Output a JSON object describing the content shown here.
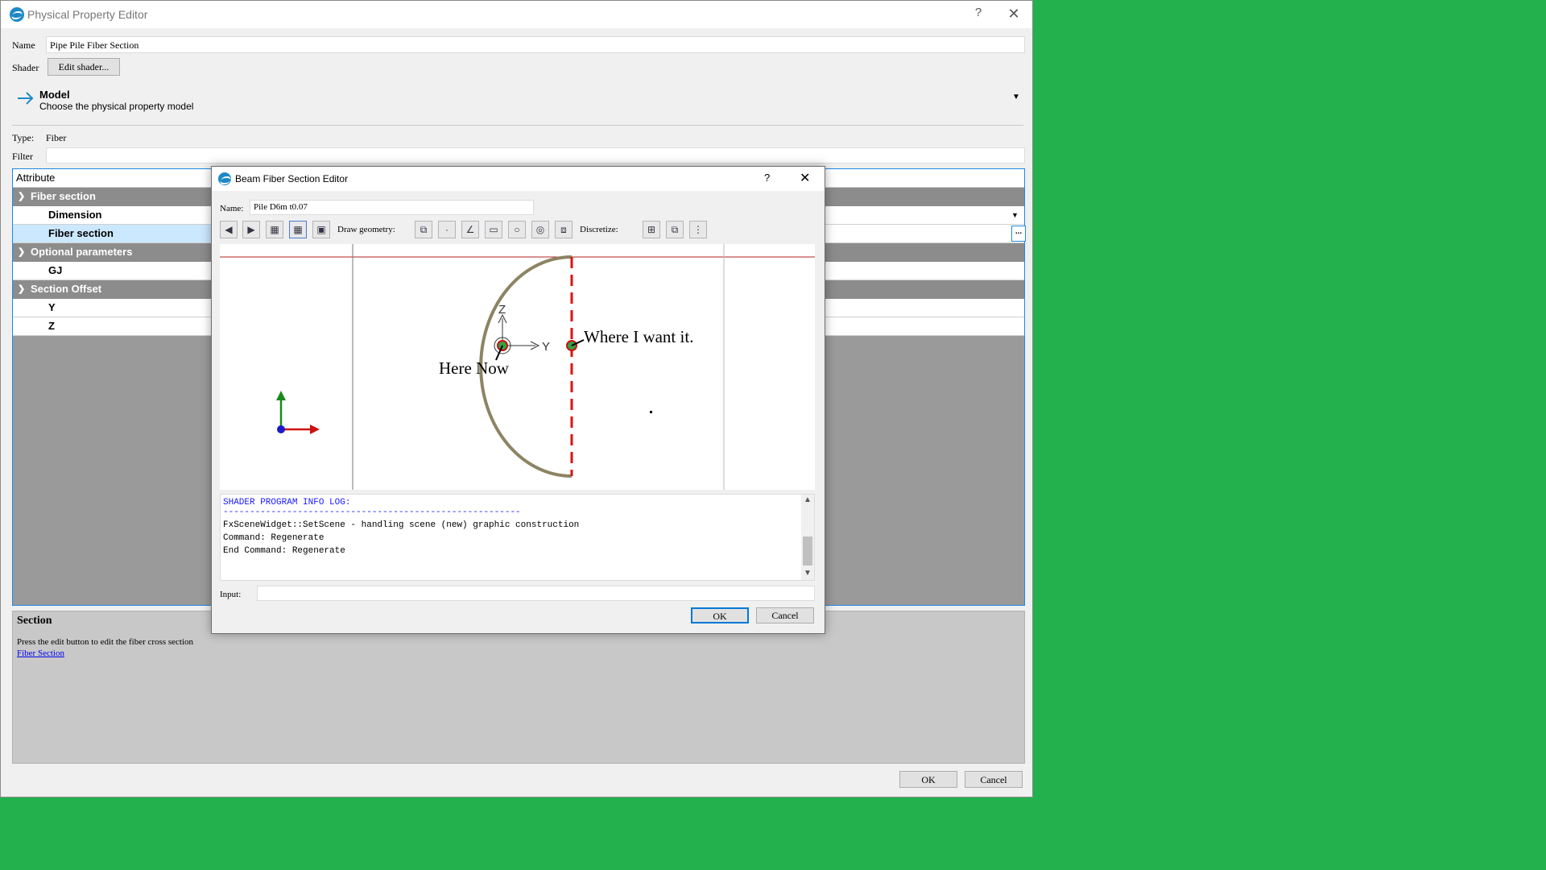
{
  "main_window": {
    "title": "Physical Property Editor",
    "help_glyph": "?",
    "close_glyph": "✕",
    "name_label": "Name",
    "name_value": "Pipe Pile Fiber Section",
    "shader_label": "Shader",
    "edit_shader_label": "Edit shader...",
    "model_title": "Model",
    "model_subtitle": "Choose the physical property model",
    "type_label": "Type:",
    "type_value": "Fiber",
    "filter_label": "Filter",
    "filter_value": "",
    "table": {
      "header": "Attribute",
      "groups": [
        {
          "label": "Fiber section",
          "items": [
            "Dimension",
            "Fiber section"
          ]
        },
        {
          "label": "Optional parameters",
          "items": [
            "GJ"
          ]
        },
        {
          "label": "Section Offset",
          "items": [
            "Y",
            "Z"
          ]
        }
      ],
      "browse_glyph": "..."
    },
    "section_panel": {
      "title": "Section",
      "description": "Press the edit button to edit the fiber cross section",
      "link": "Fiber Section"
    },
    "ok_label": "OK",
    "cancel_label": "Cancel"
  },
  "dialog": {
    "title": "Beam Fiber Section Editor",
    "help_glyph": "?",
    "close_glyph": "✕",
    "name_label": "Name:",
    "name_value": "Pile D6m t0.07",
    "draw_geometry_label": "Draw geometry:",
    "discretize_label": "Discretize:",
    "canvas": {
      "axis_z": "Z",
      "axis_y": "Y",
      "annotation_target": "Where I want it.",
      "annotation_current": "Here Now"
    },
    "log": {
      "line1": "SHADER PROGRAM INFO LOG:",
      "line2": "--------------------------------------------------------",
      "line3": "FxSceneWidget::SetScene - handling scene (new) graphic construction",
      "line4": "Command: Regenerate",
      "line5": "End Command: Regenerate"
    },
    "input_label": "Input:",
    "input_value": "",
    "ok_label": "OK",
    "cancel_label": "Cancel"
  },
  "colors": {
    "desktop": "#22b14c",
    "accent": "#1e88c7",
    "group_row": "#8c8c8c",
    "selected_row": "#cce8ff",
    "arc": "#8c8463",
    "dashed": "#dd1111",
    "log_blue": "#1a1aff"
  }
}
